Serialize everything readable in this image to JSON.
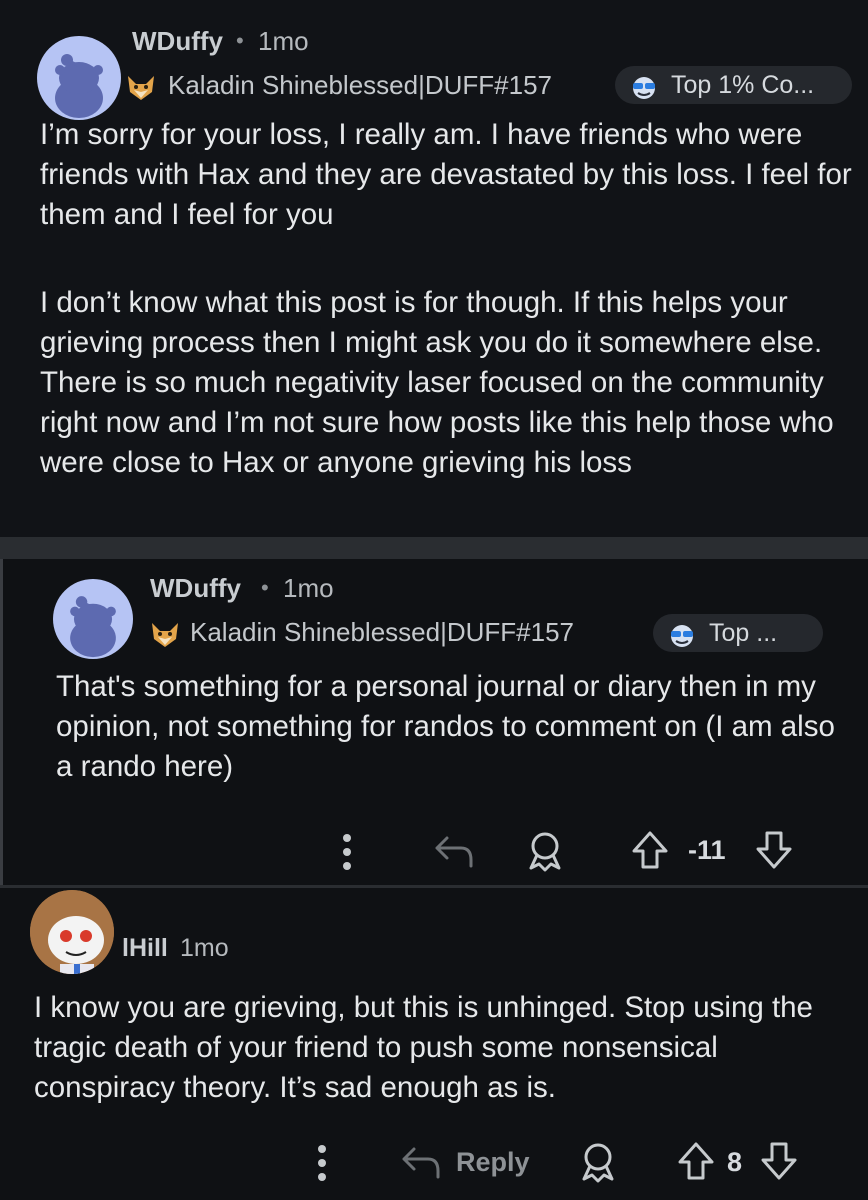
{
  "comments": [
    {
      "username": "WDuffy",
      "separator": "•",
      "age": "1mo",
      "flair": "Kaladin Shineblessed|DUFF#157",
      "badge": "Top 1% Co...",
      "paragraphs": [
        "I’m sorry for your loss, I really am. I have friends who were friends with Hax and they are devastated by this loss. I feel for them and I feel for you",
        "I don’t know what this post is for though. If this helps your grieving process then I might ask you do it somewhere else. There is so much negativity laser focused on the community right now and I’m not sure how posts like this help those who were close to Hax or anyone grieving his loss"
      ]
    },
    {
      "username": "WDuffy",
      "separator": "•",
      "age": "1mo",
      "flair": "Kaladin Shineblessed|DUFF#157",
      "badge": "Top ...",
      "paragraphs": [
        "That's something for a personal journal or diary then in my opinion, not something for randos to comment on (I am also a rando here)"
      ],
      "score": "-11"
    },
    {
      "username": "lHill",
      "age": "1mo",
      "paragraphs": [
        "I know you are grieving, but this is unhinged. Stop using the tragic death of your friend to push some nonsensical conspiracy theory. It’s sad enough as is."
      ],
      "reply_label": "Reply",
      "score": "8"
    }
  ],
  "icons": {
    "more": "more-vertical-icon",
    "reply": "reply-arrow-icon",
    "award": "award-icon",
    "upvote": "upvote-arrow-icon",
    "downvote": "downvote-arrow-icon",
    "flair": "fox-flair-icon",
    "badge": "sunglasses-badge-icon"
  },
  "colors": {
    "background": "#0f1114",
    "avatar": "#b6c4f4",
    "text": "#e6e8ea",
    "muted": "#8e9296"
  }
}
